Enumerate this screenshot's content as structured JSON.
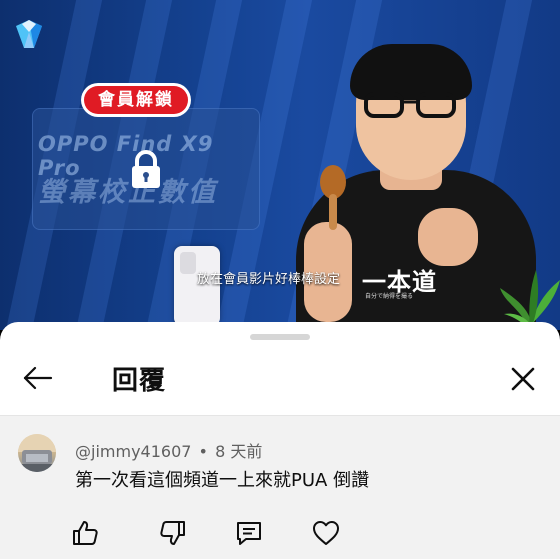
{
  "video": {
    "promo_badge": "會員解鎖",
    "promo_title": "OPPO Find X9 Pro",
    "promo_subtitle": "螢幕校正數值",
    "caption": "放在會員影片好棒棒設定",
    "tshirt_text": "一本道",
    "tshirt_subtext": "自分で納得を撮る"
  },
  "sheet": {
    "title": "回覆",
    "back_icon": "arrow-left-icon",
    "close_icon": "close-icon"
  },
  "comment": {
    "author": "@jimmy41607",
    "separator": "•",
    "time": "8 天前",
    "text": "第一次看這個頻道一上來就PUA 倒讚",
    "actions": [
      "thumb-up-icon",
      "thumb-down-icon",
      "reply-icon",
      "heart-icon"
    ]
  },
  "colors": {
    "badge_red": "#e01b24",
    "sheet_bg": "#ffffff",
    "comment_bg": "#f2f2f2",
    "text_primary": "#0f0f0f",
    "text_secondary": "#606060"
  }
}
